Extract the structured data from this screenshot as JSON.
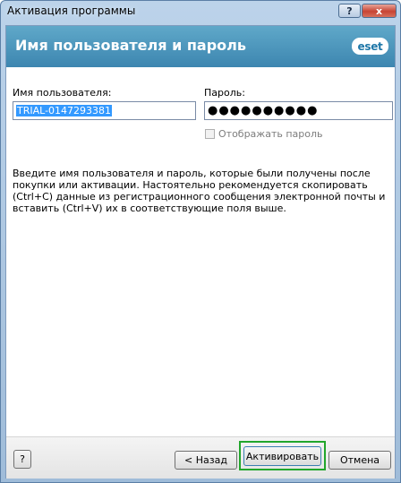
{
  "window": {
    "title": "Активация программы",
    "help_button": "?",
    "close_button": "x"
  },
  "header": {
    "title": "Имя пользователя и пароль",
    "logo": "eset"
  },
  "form": {
    "username_label": "Имя пользователя:",
    "username_value": "TRIAL-0147293381",
    "password_label": "Пароль:",
    "password_value": "●●●●●●●●●●",
    "show_password_label": "Отображать пароль",
    "show_password_checked": false,
    "description": "Введите имя пользователя и пароль, которые были получены после покупки или активации. Настоятельно рекомендуется скопировать (Ctrl+C) данные из регистрационного сообщения электронной почты и вставить (Ctrl+V) их в соответствующие поля выше."
  },
  "footer": {
    "help_label": "?",
    "back_label": "< Назад",
    "activate_label": "Активировать",
    "cancel_label": "Отмена"
  },
  "colors": {
    "header_blue": "#4a93bb",
    "highlight_green": "#22a62c",
    "selection_blue": "#3399ff"
  }
}
